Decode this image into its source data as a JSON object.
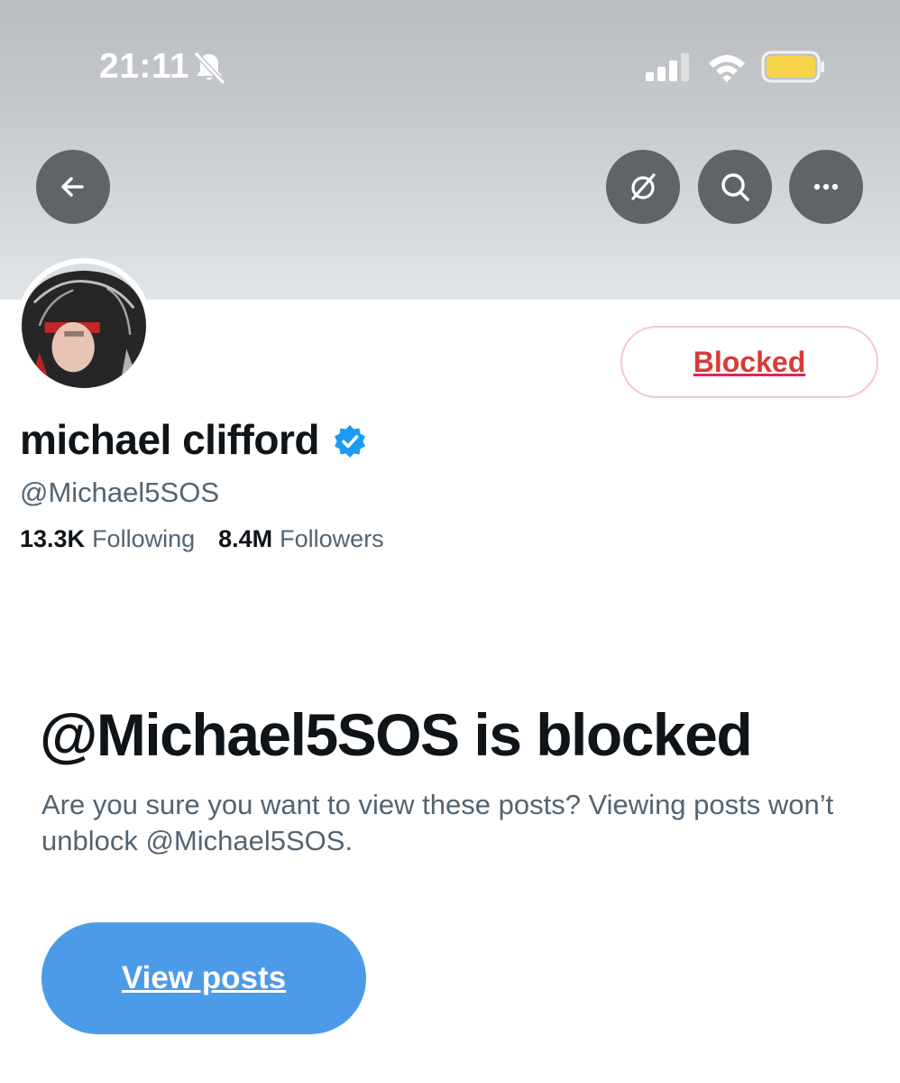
{
  "status_bar": {
    "time": "21:11",
    "icons": [
      "bell-slash-icon",
      "signal-icon",
      "wifi-icon",
      "battery-icon"
    ],
    "battery_color": "#f7d34a"
  },
  "header": {
    "buttons": [
      "back-arrow-icon",
      "grok-icon",
      "search-icon",
      "more-icon"
    ]
  },
  "profile": {
    "display_name": "michael clifford",
    "verified": true,
    "handle": "@Michael5SOS",
    "following_count": "13.3K",
    "following_label": "Following",
    "followers_count": "8.4M",
    "followers_label": "Followers",
    "blocked_button_label": "Blocked"
  },
  "blocked_notice": {
    "title": "@Michael5SOS is blocked",
    "description": "Are you sure you want to view these posts? Viewing posts won’t unblock @Michael5SOS.",
    "view_button_label": "View posts"
  },
  "colors": {
    "accent": "#4c9be8",
    "verified": "#1d9bf0",
    "blocked_text": "#d93a35",
    "secondary_text": "#536471"
  }
}
